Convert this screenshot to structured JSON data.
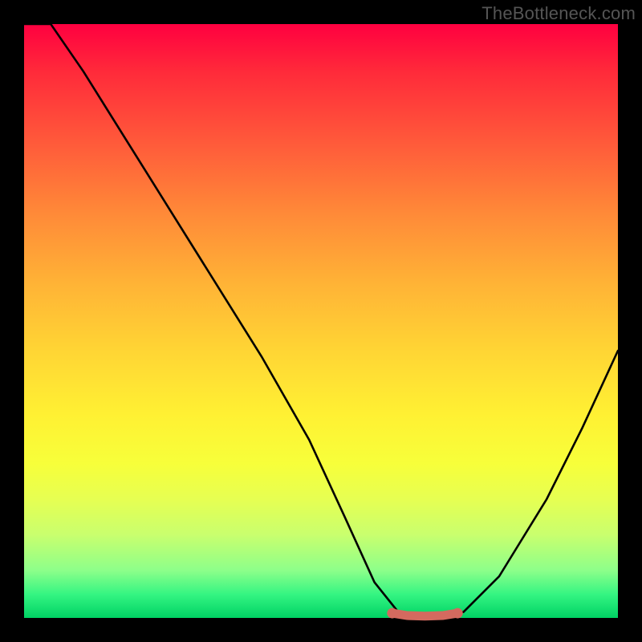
{
  "attribution": "TheBottleneck.com",
  "chart_data": {
    "type": "line",
    "title": "",
    "xlabel": "",
    "ylabel": "",
    "xlim": [
      0,
      100
    ],
    "ylim": [
      0,
      100
    ],
    "series": [
      {
        "name": "bottleneck-curve",
        "x": [
          0,
          4.5,
          10,
          20,
          30,
          40,
          48,
          54,
          59,
          63,
          66,
          70,
          74,
          80,
          88,
          94,
          100
        ],
        "values": [
          100,
          100,
          92,
          76,
          60,
          44,
          30,
          17,
          6,
          1,
          0,
          0,
          1,
          7,
          20,
          32,
          45
        ]
      }
    ],
    "highlight": {
      "name": "optimal-segment",
      "x": [
        62,
        64.5,
        67.5,
        70.5,
        73
      ],
      "values": [
        0.8,
        0.4,
        0.3,
        0.4,
        0.8
      ],
      "color": "#d46a5f"
    },
    "colors": {
      "curve": "#000000",
      "highlight": "#d46a5f",
      "gradient_top": "#ff0040",
      "gradient_bottom": "#00d264"
    }
  }
}
